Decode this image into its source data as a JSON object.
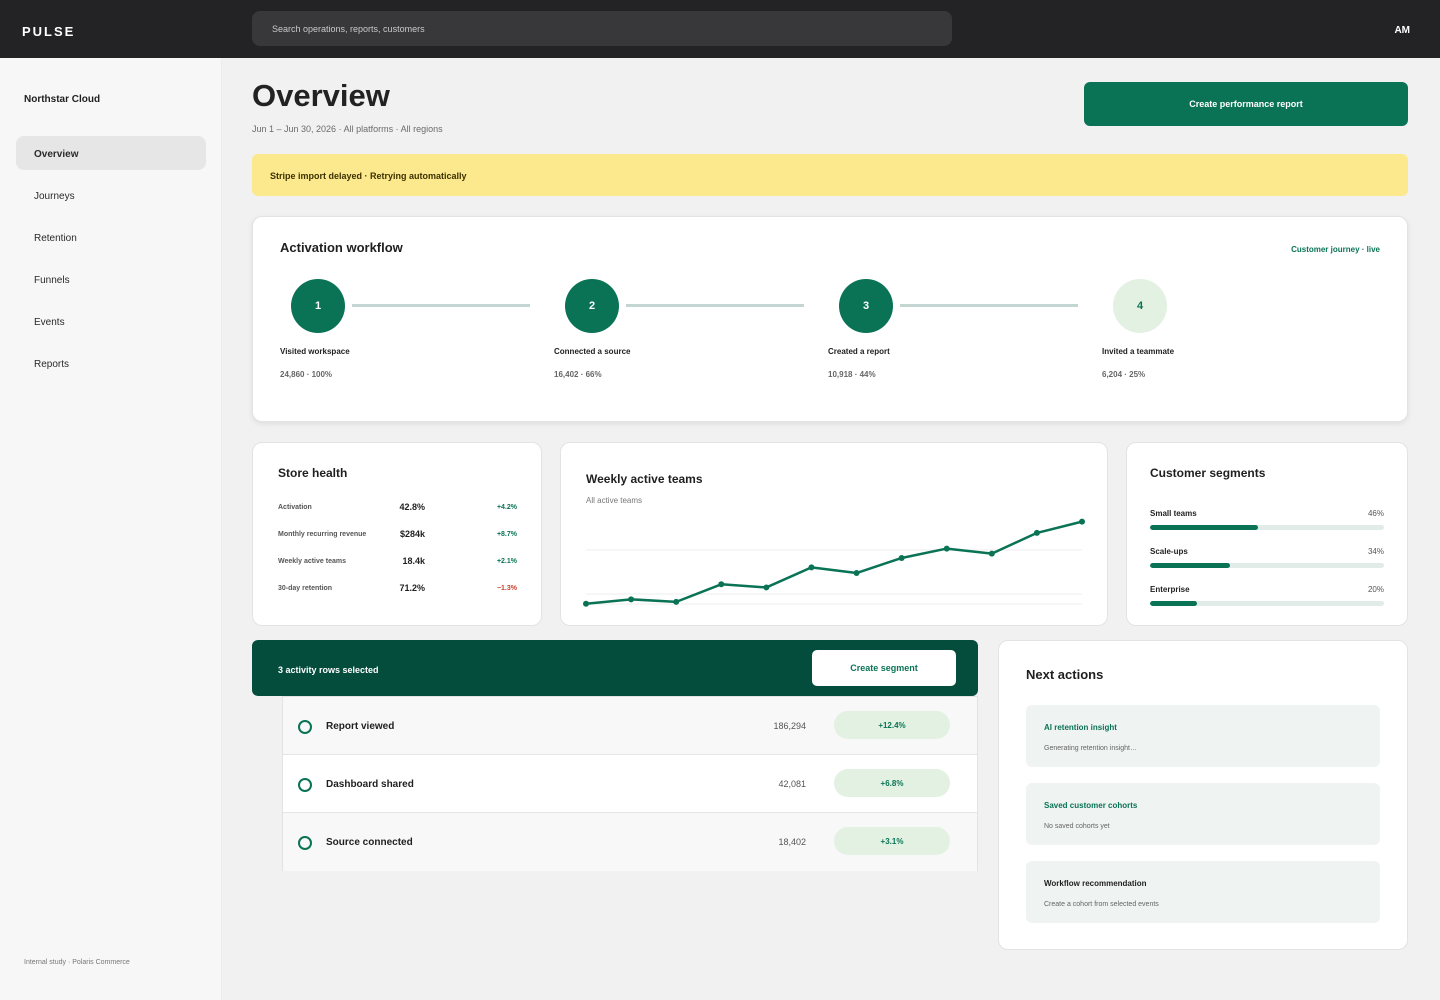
{
  "app": {
    "logo": "PULSE",
    "avatar_initials": "AM"
  },
  "search": {
    "placeholder": "Search operations, reports, customers"
  },
  "sidebar": {
    "workspace": "Northstar Cloud",
    "items": [
      {
        "label": "Overview",
        "active": true
      },
      {
        "label": "Journeys"
      },
      {
        "label": "Retention"
      },
      {
        "label": "Funnels"
      },
      {
        "label": "Events"
      },
      {
        "label": "Reports"
      }
    ],
    "footer": "Internal study · Polaris Commerce"
  },
  "header": {
    "title": "Overview",
    "subtitle": "Jun 1 – Jun 30, 2026 · All platforms · All regions",
    "primary_button": "Create performance report"
  },
  "alert": {
    "text": "Stripe import delayed · Retrying automatically"
  },
  "workflow": {
    "title": "Activation workflow",
    "tag": "Customer journey · live",
    "steps": [
      {
        "number": "1",
        "label": "Visited workspace",
        "stat": "24,860 · 100%",
        "done": true
      },
      {
        "number": "2",
        "label": "Connected a source",
        "stat": "16,402 · 66%",
        "done": true
      },
      {
        "number": "3",
        "label": "Created a report",
        "stat": "10,918 · 44%",
        "done": true
      },
      {
        "number": "4",
        "label": "Invited a teammate",
        "stat": "6,204 · 25%",
        "done": false
      }
    ]
  },
  "store_health": {
    "title": "Store health",
    "rows": [
      {
        "label": "Activation",
        "value": "42.8%",
        "delta": "+4.2%"
      },
      {
        "label": "Monthly recurring revenue",
        "value": "$284k",
        "delta": "+8.7%"
      },
      {
        "label": "Weekly active teams",
        "value": "18.4k",
        "delta": "+2.1%"
      },
      {
        "label": "30-day retention",
        "value": "71.2%",
        "delta": "−1.3%"
      }
    ]
  },
  "weekly": {
    "title": "Weekly active teams",
    "subtitle": "All active teams"
  },
  "chart_data": {
    "type": "line",
    "title": "Weekly active teams",
    "subtitle": "All active teams",
    "x": [
      1,
      2,
      3,
      4,
      5,
      6,
      7,
      8,
      9,
      10,
      11,
      12
    ],
    "series": [
      {
        "values": [
          0.0,
          0.7,
          0.3,
          3.1,
          2.6,
          5.8,
          4.9,
          7.3,
          8.8,
          8.0,
          11.3,
          13.1
        ]
      }
    ],
    "ylim": [
      -1,
      14
    ],
    "grid": true,
    "color": "#0a7355"
  },
  "segments": {
    "title": "Customer segments",
    "items": [
      {
        "name": "Small teams",
        "pct_label": "46%",
        "fraction": 0.46
      },
      {
        "name": "Scale-ups",
        "pct_label": "34%",
        "fraction": 0.34
      },
      {
        "name": "Enterprise",
        "pct_label": "20%",
        "fraction": 0.2
      }
    ]
  },
  "selection": {
    "text": "3 activity rows selected",
    "button": "Create segment"
  },
  "activity": {
    "rows": [
      {
        "name": "Report viewed",
        "value": "186,294",
        "delta": "+12.4%"
      },
      {
        "name": "Dashboard shared",
        "value": "42,081",
        "delta": "+6.8%"
      },
      {
        "name": "Source connected",
        "value": "18,402",
        "delta": "+3.1%"
      }
    ]
  },
  "next_actions": {
    "title": "Next actions",
    "items": [
      {
        "title": "AI retention insight",
        "sub": "Generating retention insight…"
      },
      {
        "title": "Saved customer cohorts",
        "sub": "No saved cohorts yet"
      },
      {
        "title": "Workflow recommendation",
        "sub": "Create a cohort from selected events"
      }
    ]
  },
  "colors": {
    "brand": "#0a7355",
    "brand_dark": "#044c3c",
    "alert": "#fde98d",
    "negative": "#c8432b",
    "topbar": "#232325"
  }
}
